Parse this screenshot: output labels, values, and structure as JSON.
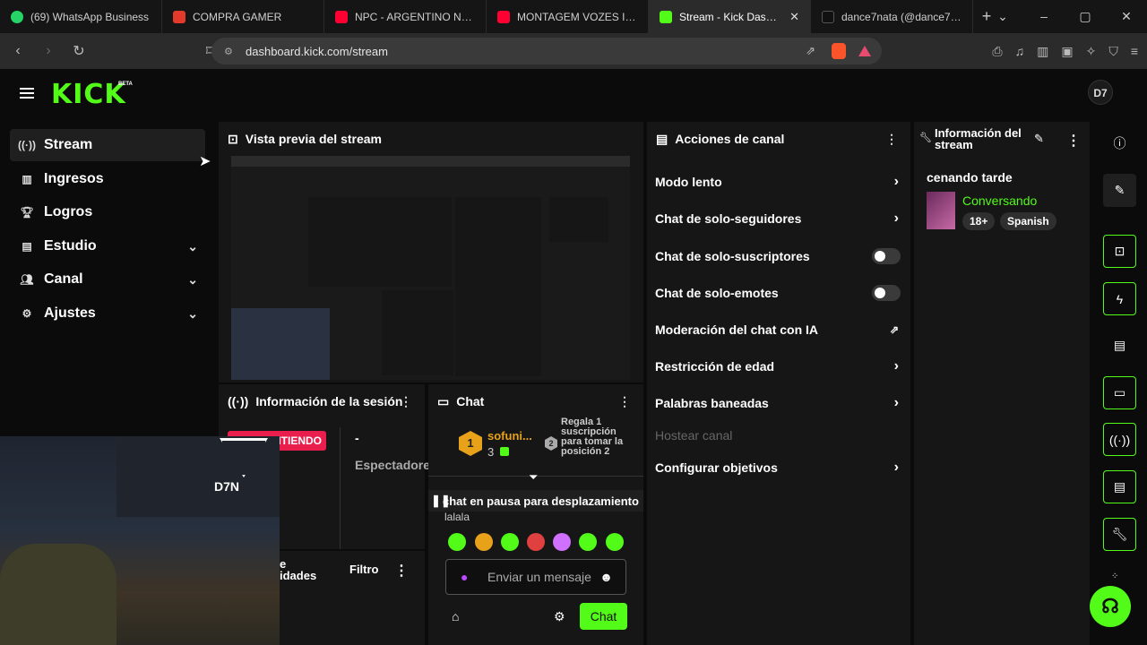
{
  "browser": {
    "tabs": [
      {
        "title": "(69) WhatsApp Business",
        "color": "#25d366"
      },
      {
        "title": "COMPRA GAMER",
        "color": "#e43a2c"
      },
      {
        "title": "NPC - ARGENTINO NATUR",
        "color": "#ff0033"
      },
      {
        "title": "MONTAGEM VOZES INDIC",
        "color": "#ff0033"
      },
      {
        "title": "Stream - Kick Dashboa",
        "color": "#53fc18"
      },
      {
        "title": "dance7nata (@dance7nata",
        "color": "#111111"
      }
    ],
    "url": "dashboard.kick.com/stream",
    "new_tab": "+",
    "close": "✕"
  },
  "header": {
    "logo": "KICK",
    "beta": "BETA",
    "avatar": "D7"
  },
  "sidebar": {
    "items": [
      {
        "label": "Stream",
        "icon": "broadcast-icon"
      },
      {
        "label": "Ingresos",
        "icon": "chart-icon"
      },
      {
        "label": "Logros",
        "icon": "trophy-icon"
      },
      {
        "label": "Estudio",
        "icon": "studio-icon"
      },
      {
        "label": "Canal",
        "icon": "users-icon"
      },
      {
        "label": "Ajustes",
        "icon": "gear-icon"
      }
    ]
  },
  "preview": {
    "title": "Vista previa del stream"
  },
  "actions": {
    "title": "Acciones de canal",
    "items": [
      {
        "label": "Modo lento"
      },
      {
        "label": "Chat de solo-seguidores"
      },
      {
        "label": "Chat de solo-suscriptores"
      },
      {
        "label": "Chat de solo-emotes"
      },
      {
        "label": "Moderación del chat con IA"
      },
      {
        "label": "Restricción de edad"
      },
      {
        "label": "Palabras baneadas"
      },
      {
        "label": "Hostear canal"
      },
      {
        "label": "Configurar objetivos"
      }
    ]
  },
  "info": {
    "title": "Información del stream",
    "stream_title": "cenando tarde",
    "category": "Conversando",
    "tags": [
      "18+",
      "Spanish"
    ]
  },
  "session": {
    "title": "Información de la sesión",
    "live": "TRANSMITIENDO",
    "viewers_value": "-",
    "viewers_label": "Espectadore"
  },
  "activity": {
    "title": "e\nidades",
    "filter": "Filtro"
  },
  "chat": {
    "title": "Chat",
    "leader_rank": "1",
    "leader_name": "sofuni...",
    "leader_count": "3",
    "gift_rank": "2",
    "gift_text": "Regala 1 suscripción para tomar la posición 2",
    "paused": "chat en pausa para desplazamiento",
    "last_message": "lalala",
    "input_placeholder": "Enviar un mensaje",
    "send": "Chat"
  },
  "webcam": {
    "brand": "D7N"
  }
}
